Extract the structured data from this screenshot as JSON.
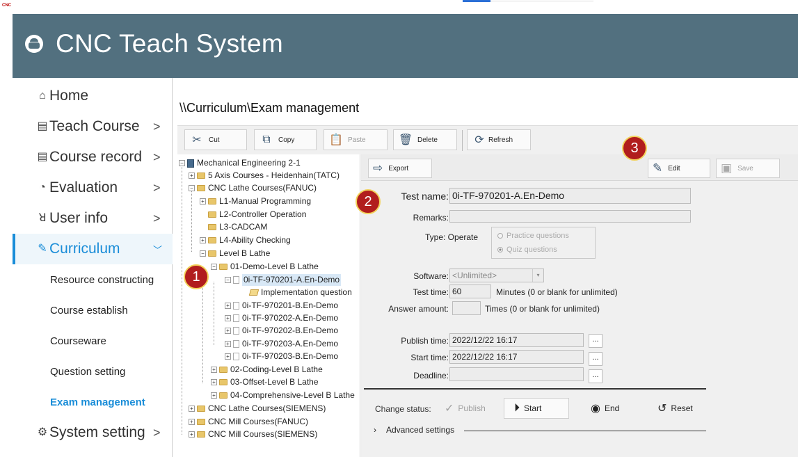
{
  "topbar": {
    "icon_text": "CNC"
  },
  "header": {
    "title": "CNC Teach System"
  },
  "sidebar": {
    "items": [
      {
        "label": "Home",
        "icon": "home-icon",
        "chevron": ""
      },
      {
        "label": "Teach Course",
        "icon": "monitor-icon",
        "chevron": ">"
      },
      {
        "label": "Course record",
        "icon": "document-icon",
        "chevron": ">"
      },
      {
        "label": "Evaluation",
        "icon": "pie-chart-icon",
        "chevron": ">"
      },
      {
        "label": "User info",
        "icon": "user-icon",
        "chevron": ">"
      },
      {
        "label": "Curriculum",
        "icon": "pencil-icon",
        "chevron": "﹀"
      },
      {
        "label": "System setting",
        "icon": "gear-icon",
        "chevron": ">"
      }
    ],
    "sub_items": [
      {
        "label": "Resource constructing"
      },
      {
        "label": "Course establish"
      },
      {
        "label": "Courseware"
      },
      {
        "label": "Question setting"
      },
      {
        "label": "Exam management"
      }
    ],
    "active_color": "#1a8dd8"
  },
  "breadcrumb": "\\\\Curriculum\\Exam management",
  "toolbar": {
    "cut": "Cut",
    "copy": "Copy",
    "paste": "Paste",
    "delete": "Delete",
    "refresh": "Refresh"
  },
  "tree": {
    "nodes": [
      {
        "label": "Mechanical Engineering 2-1"
      },
      {
        "label": "5 Axis Courses - Heidenhain(TATC)"
      },
      {
        "label": "CNC Lathe Courses(FANUC)"
      },
      {
        "label": "L1-Manual Programming"
      },
      {
        "label": "L2-Controller Operation"
      },
      {
        "label": "L3-CADCAM"
      },
      {
        "label": "L4-Ability Checking"
      },
      {
        "label": "Level B Lathe"
      },
      {
        "label": "01-Demo-Level B Lathe"
      },
      {
        "label": "0i-TF-970201-A.En-Demo"
      },
      {
        "label": "Implementation question"
      },
      {
        "label": "0i-TF-970201-B.En-Demo"
      },
      {
        "label": "0i-TF-970202-A.En-Demo"
      },
      {
        "label": "0i-TF-970202-B.En-Demo"
      },
      {
        "label": "0i-TF-970203-A.En-Demo"
      },
      {
        "label": "0i-TF-970203-B.En-Demo"
      },
      {
        "label": "02-Coding-Level B Lathe"
      },
      {
        "label": "03-Offset-Level B Lathe"
      },
      {
        "label": "04-Comprehensive-Level B Lathe"
      },
      {
        "label": "CNC Lathe Courses(SIEMENS)"
      },
      {
        "label": "CNC Mill Courses(FANUC)"
      },
      {
        "label": "CNC Mill Courses(SIEMENS)"
      }
    ]
  },
  "detail": {
    "export": "Export",
    "edit": "Edit",
    "save": "Save",
    "test_name_label": "Test name:",
    "test_name_value": "0i-TF-970201-A.En-Demo",
    "remarks_label": "Remarks:",
    "remarks_value": "",
    "type_label": "Type: Operate",
    "practice_label": "Practice questions",
    "quiz_label": "Quiz questions",
    "software_label": "Software:",
    "software_value": "<Unlimited>",
    "test_time_label": "Test time:",
    "test_time_value": "60",
    "test_time_hint": "Minutes (0 or blank for unlimited)",
    "answer_amount_label": "Answer amount:",
    "answer_amount_value": "",
    "answer_amount_hint": "Times (0 or blank for unlimited)",
    "publish_time_label": "Publish time:",
    "publish_time_value": "2022/12/22 16:17",
    "start_time_label": "Start time:",
    "start_time_value": "2022/12/22 16:17",
    "deadline_label": "Deadline:",
    "deadline_value": "",
    "dots": "...",
    "change_status_label": "Change status:",
    "publish": "Publish",
    "start": "Start",
    "end": "End",
    "reset": "Reset",
    "advanced": "Advanced settings"
  },
  "badges": {
    "one": "1",
    "two": "2",
    "three": "3"
  }
}
